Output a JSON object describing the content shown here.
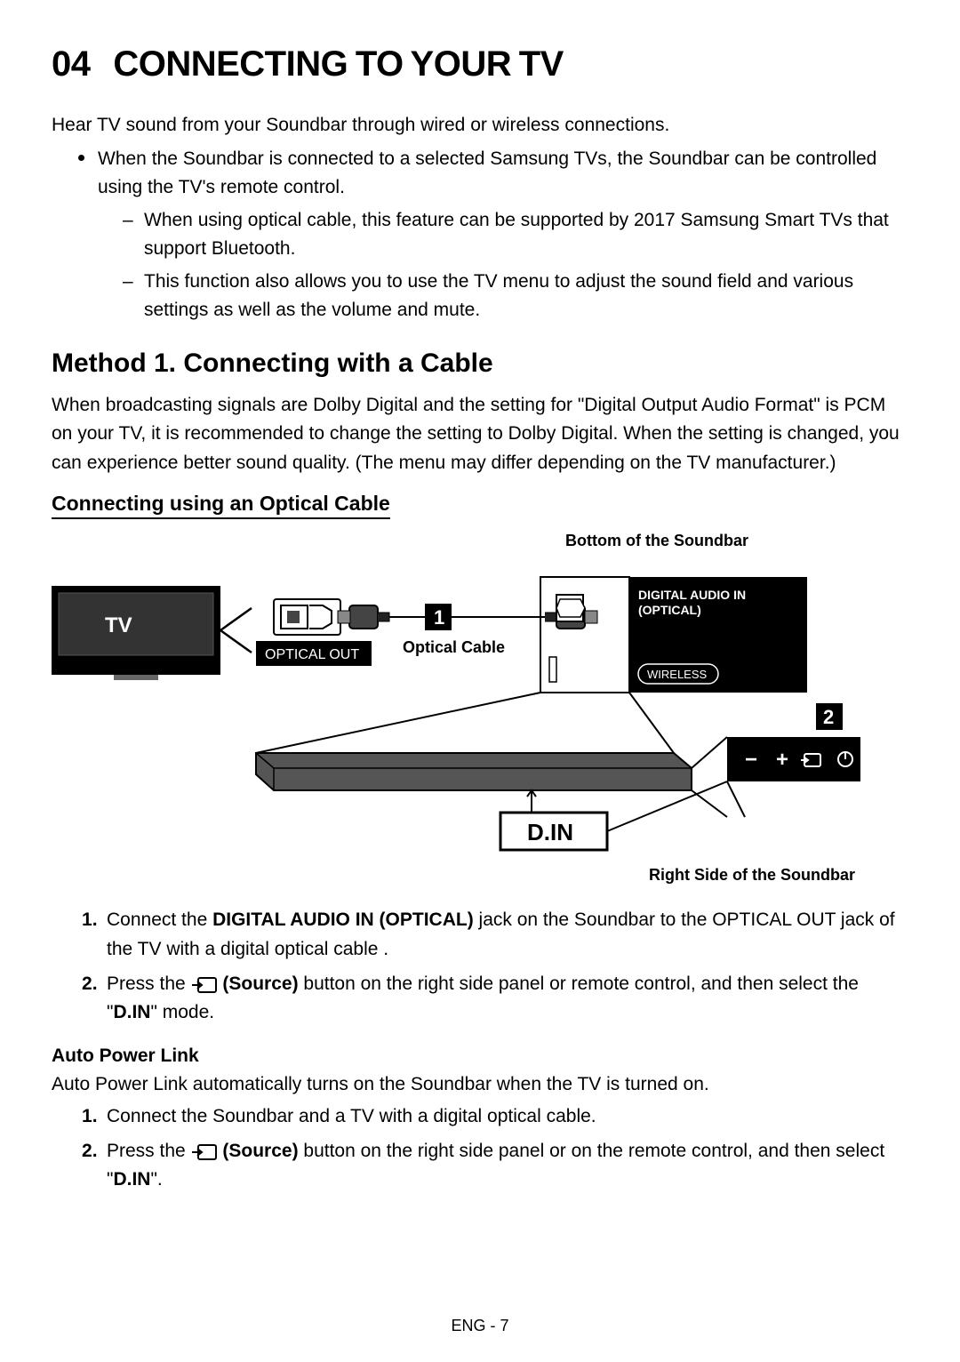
{
  "section_number": "04",
  "section_title": "CONNECTING TO YOUR TV",
  "intro": "Hear TV sound from your Soundbar through wired or wireless connections.",
  "bullets": [
    {
      "text": "When the Soundbar is connected to a selected Samsung TVs, the Soundbar can be controlled using the TV's remote control.",
      "subdashes": [
        "When using optical cable, this feature can be supported by 2017 Samsung Smart TVs that support Bluetooth.",
        "This function also allows you to use the TV menu to adjust the sound field and various settings as well as the volume and mute."
      ]
    }
  ],
  "method_title": "Method 1. Connecting with a Cable",
  "method_intro": "When broadcasting signals are Dolby Digital and the setting for \"Digital Output Audio Format\" is PCM on your TV, it is recommended to change the setting to Dolby Digital. When the setting is changed, you can experience better sound quality. (The menu may differ depending on the TV manufacturer.)",
  "subheading": "Connecting using an Optical Cable",
  "diagram": {
    "top_label": "Bottom of the Soundbar",
    "bottom_label": "Right Side of the Soundbar",
    "tv_label": "TV",
    "tv_port": "OPTICAL OUT",
    "cable_label": "Optical Cable",
    "step1": "1",
    "step2": "2",
    "port_label_1": "DIGITAL AUDIO IN",
    "port_label_2": "(OPTICAL)",
    "wireless": "WIRELESS",
    "mode": "D.IN"
  },
  "steps1": {
    "s1_a": "Connect the ",
    "s1_b": "DIGITAL AUDIO IN (OPTICAL)",
    "s1_c": " jack on the Soundbar to the OPTICAL OUT jack of the TV with a digital optical cable .",
    "s2_a": "Press the ",
    "s2_b": " (Source)",
    "s2_c": " button on the right side panel or remote control, and then select the \"",
    "s2_d": "D.IN",
    "s2_e": "\" mode."
  },
  "apl_title": "Auto Power Link",
  "apl_intro": "Auto Power Link automatically turns on the Soundbar when the TV is turned on.",
  "steps2": {
    "s1": "Connect the Soundbar and a TV with a digital optical cable.",
    "s2_a": "Press the ",
    "s2_b": " (Source)",
    "s2_c": " button on the right side panel or on the remote control, and then select \"",
    "s2_d": "D.IN",
    "s2_e": "\"."
  },
  "footer": "ENG - 7"
}
